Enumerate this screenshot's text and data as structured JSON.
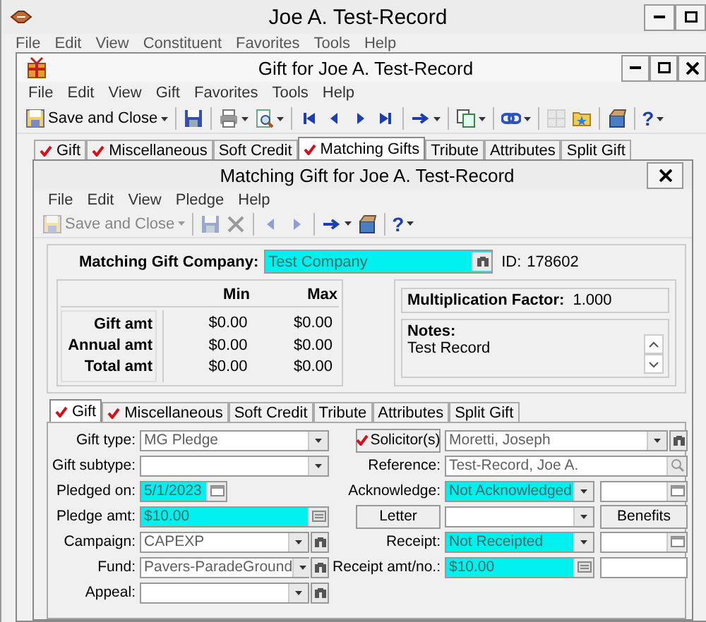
{
  "main_window": {
    "title": "Joe A. Test-Record",
    "menu": [
      "File",
      "Edit",
      "View",
      "Constituent",
      "Favorites",
      "Tools",
      "Help"
    ]
  },
  "gift_window": {
    "title": "Gift for Joe A. Test-Record",
    "menu": [
      "File",
      "Edit",
      "View",
      "Gift",
      "Favorites",
      "Tools",
      "Help"
    ],
    "toolbar": [
      {
        "kind": "save_close",
        "text": "Save and Close",
        "dropdown": true,
        "disabled": false
      },
      {
        "kind": "separator"
      },
      {
        "kind": "save",
        "dropdown": false,
        "disabled": false
      },
      {
        "kind": "separator"
      },
      {
        "kind": "print",
        "dropdown": true,
        "disabled": false
      },
      {
        "kind": "preview",
        "dropdown": true,
        "disabled": false
      },
      {
        "kind": "separator"
      },
      {
        "kind": "first",
        "dropdown": false,
        "disabled": false
      },
      {
        "kind": "prev",
        "dropdown": false,
        "disabled": false
      },
      {
        "kind": "next",
        "dropdown": false,
        "disabled": false
      },
      {
        "kind": "last",
        "dropdown": false,
        "disabled": false
      },
      {
        "kind": "separator"
      },
      {
        "kind": "arrow",
        "dropdown": true,
        "disabled": false
      },
      {
        "kind": "separator"
      },
      {
        "kind": "copy",
        "dropdown": true,
        "disabled": false
      },
      {
        "kind": "separator"
      },
      {
        "kind": "link",
        "dropdown": true,
        "disabled": false
      },
      {
        "kind": "separator"
      },
      {
        "kind": "tile",
        "dropdown": false,
        "disabled": true
      },
      {
        "kind": "folder",
        "dropdown": false,
        "disabled": false
      },
      {
        "kind": "separator"
      },
      {
        "kind": "box",
        "dropdown": false,
        "disabled": false
      },
      {
        "kind": "separator"
      },
      {
        "kind": "help",
        "text": "?",
        "dropdown": true,
        "disabled": false
      }
    ],
    "tabs": [
      {
        "label": "Gift",
        "checked": true,
        "selected": false
      },
      {
        "label": "Miscellaneous",
        "checked": true,
        "selected": false
      },
      {
        "label": "Soft Credit",
        "checked": false,
        "selected": false
      },
      {
        "label": "Matching Gifts",
        "checked": true,
        "selected": true
      },
      {
        "label": "Tribute",
        "checked": false,
        "selected": false
      },
      {
        "label": "Attributes",
        "checked": false,
        "selected": false
      },
      {
        "label": "Split Gift",
        "checked": false,
        "selected": false
      }
    ]
  },
  "dialog": {
    "title": "Matching Gift for Joe A. Test-Record",
    "menu": [
      "File",
      "Edit",
      "View",
      "Pledge",
      "Help"
    ],
    "toolbar": [
      {
        "kind": "save_close",
        "text": "Save and Close",
        "dropdown": true,
        "disabled": true
      },
      {
        "kind": "separator"
      },
      {
        "kind": "save",
        "dropdown": false,
        "disabled": true
      },
      {
        "kind": "delete",
        "dropdown": false,
        "disabled": true
      },
      {
        "kind": "separator"
      },
      {
        "kind": "prev",
        "dropdown": false,
        "disabled": true
      },
      {
        "kind": "next",
        "dropdown": false,
        "disabled": true
      },
      {
        "kind": "separator"
      },
      {
        "kind": "arrow",
        "dropdown": true,
        "disabled": false
      },
      {
        "kind": "box",
        "dropdown": false,
        "disabled": false
      },
      {
        "kind": "separator"
      },
      {
        "kind": "help",
        "text": "?",
        "dropdown": true,
        "disabled": false
      }
    ],
    "company": {
      "label": "Matching Gift Company:",
      "value": "Test Company",
      "highlighted": true
    },
    "id": {
      "label": "ID:",
      "value": "178602"
    },
    "amounts": {
      "columns": [
        "Min",
        "Max"
      ],
      "rows": [
        {
          "label": "Gift amt",
          "min": "$0.00",
          "max": "$0.00"
        },
        {
          "label": "Annual amt",
          "min": "$0.00",
          "max": "$0.00"
        },
        {
          "label": "Total amt",
          "min": "$0.00",
          "max": "$0.00"
        }
      ]
    },
    "factor": {
      "label": "Multiplication Factor:",
      "value": "1.000"
    },
    "notes": {
      "label": "Notes:",
      "text": "Test Record"
    },
    "tabs": [
      {
        "label": "Gift",
        "checked": true,
        "selected": true
      },
      {
        "label": "Miscellaneous",
        "checked": true,
        "selected": false
      },
      {
        "label": "Soft Credit",
        "checked": false,
        "selected": false
      },
      {
        "label": "Tribute",
        "checked": false,
        "selected": false
      },
      {
        "label": "Attributes",
        "checked": false,
        "selected": false
      },
      {
        "label": "Split Gift",
        "checked": false,
        "selected": false
      }
    ],
    "form_left": [
      {
        "label": "Gift type:",
        "fields": [
          {
            "kind": "dropdown",
            "value": "MG Pledge",
            "highlighted": false
          }
        ]
      },
      {
        "label": "Gift subtype:",
        "fields": [
          {
            "kind": "dropdown",
            "highlighted": false
          }
        ]
      },
      {
        "label": "Pledged on:",
        "fields": [
          {
            "kind": "date",
            "value": "5/1/2023",
            "highlighted": true
          }
        ]
      },
      {
        "label": "Pledge amt:",
        "fields": [
          {
            "kind": "amount",
            "value": "$10.00",
            "highlighted": true
          }
        ]
      },
      {
        "label": "Campaign:",
        "fields": [
          {
            "kind": "lookup_dropdown",
            "value": "CAPEXP",
            "highlighted": false
          }
        ]
      },
      {
        "label": "Fund:",
        "fields": [
          {
            "kind": "lookup_dropdown",
            "value": "Pavers-ParadeGround",
            "highlighted": false
          }
        ]
      },
      {
        "label": "Appeal:",
        "fields": [
          {
            "kind": "lookup_dropdown",
            "highlighted": false
          }
        ]
      }
    ],
    "form_right": [
      {
        "button": {
          "text": "Solicitor(s)",
          "checked": true
        },
        "fields": [
          {
            "kind": "lookup_dropdown",
            "value": "Moretti, Joseph",
            "highlighted": false
          }
        ]
      },
      {
        "label": "Reference:",
        "fields": [
          {
            "kind": "search",
            "value": "Test-Record, Joe A.",
            "highlighted": false
          }
        ]
      },
      {
        "label": "Acknowledge:",
        "fields": [
          {
            "kind": "dropdown",
            "value": "Not Acknowledged",
            "highlighted": true
          },
          {
            "kind": "date",
            "highlighted": false
          }
        ]
      },
      {
        "button": {
          "text": "Letter",
          "checked": false
        },
        "fields": [
          {
            "kind": "dropdown",
            "highlighted": false
          },
          {
            "kind": "button",
            "value": "Benefits"
          }
        ]
      },
      {
        "label": "Receipt:",
        "fields": [
          {
            "kind": "dropdown",
            "value": "Not Receipted",
            "highlighted": true
          },
          {
            "kind": "date",
            "highlighted": false
          }
        ]
      },
      {
        "label": "Receipt amt/no.:",
        "fields": [
          {
            "kind": "amount",
            "value": "$10.00",
            "highlighted": true
          },
          {
            "kind": "text",
            "highlighted": false
          }
        ]
      }
    ]
  }
}
